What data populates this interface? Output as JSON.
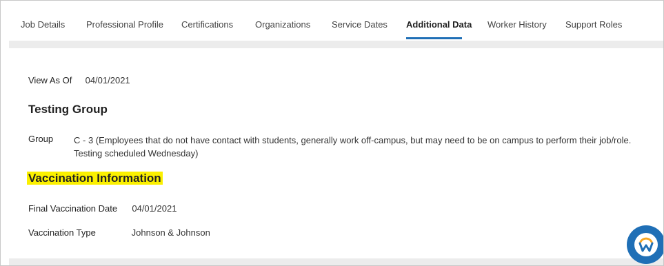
{
  "tabs": [
    {
      "label": "Job Details"
    },
    {
      "label": "Professional Profile"
    },
    {
      "label": "Certifications"
    },
    {
      "label": "Organizations"
    },
    {
      "label": "Service Dates"
    },
    {
      "label": "Additional Data",
      "active": true
    },
    {
      "label": "Worker History"
    },
    {
      "label": "Support Roles"
    }
  ],
  "view_as_of": {
    "label": "View As Of",
    "value": "04/01/2021"
  },
  "testing_group": {
    "heading": "Testing Group",
    "group_label": "Group",
    "group_value": "C - 3 (Employees that do not have contact with students, generally work off-campus, but may need to be on campus to perform their job/role. Testing scheduled Wednesday)"
  },
  "vaccination": {
    "heading": "Vaccination Information",
    "final_date_label": "Final Vaccination Date",
    "final_date_value": "04/01/2021",
    "type_label": "Vaccination Type",
    "type_value": "Johnson & Johnson"
  },
  "colors": {
    "accent": "#1f6fb6",
    "highlight": "#fbf000",
    "workday_orange": "#f5a623"
  },
  "icons": {
    "assistant": "workday-logo-icon"
  }
}
